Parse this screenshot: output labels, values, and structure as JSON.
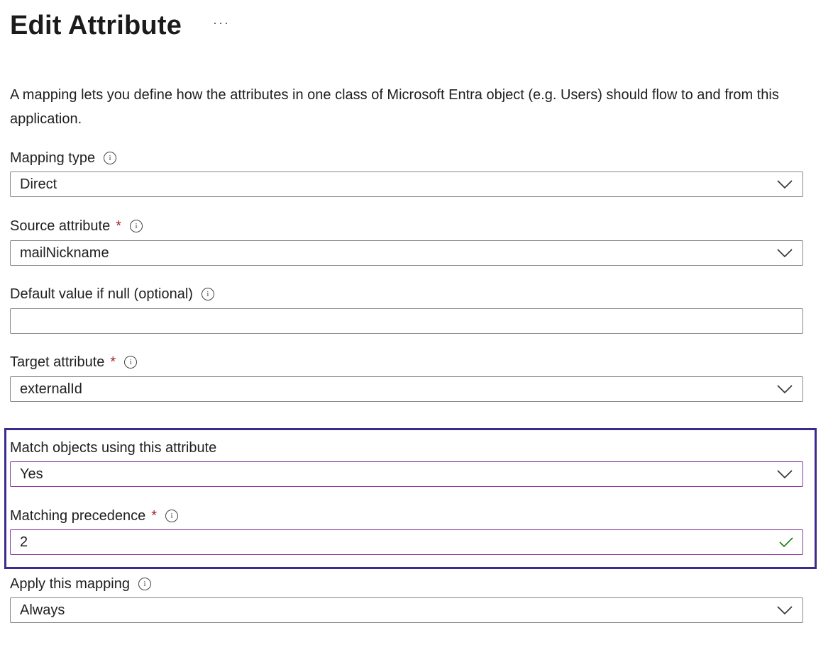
{
  "header": {
    "title": "Edit Attribute",
    "more_label": "···"
  },
  "description": "A mapping lets you define how the attributes in one class of Microsoft Entra object (e.g. Users) should flow to and from this application.",
  "fields": {
    "mapping_type": {
      "label": "Mapping type",
      "value": "Direct",
      "icon": "info-icon"
    },
    "source_attribute": {
      "label": "Source attribute",
      "required": "*",
      "value": "mailNickname",
      "icon": "info-icon"
    },
    "default_value": {
      "label": "Default value if null (optional)",
      "value": "",
      "icon": "info-icon"
    },
    "target_attribute": {
      "label": "Target attribute",
      "required": "*",
      "value": "externalId",
      "icon": "info-icon"
    },
    "match_objects": {
      "label": "Match objects using this attribute",
      "value": "Yes"
    },
    "matching_precedence": {
      "label": "Matching precedence",
      "required": "*",
      "value": "2",
      "icon": "info-icon",
      "valid_icon": "checkmark-icon"
    },
    "apply_mapping": {
      "label": "Apply this mapping",
      "value": "Always",
      "icon": "info-icon"
    }
  },
  "colors": {
    "highlight_border": "#3e2a8e",
    "focused_border": "#8a3a9e",
    "required": "#a4262c",
    "valid_check": "#107c10"
  }
}
